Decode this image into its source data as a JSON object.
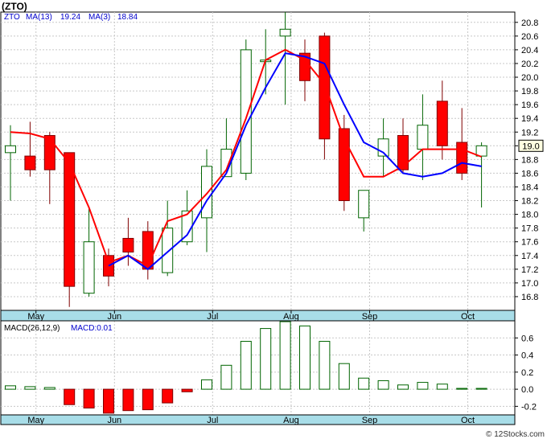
{
  "symbol": "(ZTO)",
  "watermark": "© 12Stocks.com",
  "chart_data": [
    {
      "type": "candlestick",
      "legend": {
        "ticker": "ZTO",
        "ma_long_label": "MA(13)",
        "ma_long_value": "19.24",
        "ma_short_label": "MA(3)",
        "ma_short_value": "18.84"
      },
      "colors": {
        "up": "#ffffff",
        "up_stroke": "#006400",
        "down": "#ff0000",
        "down_stroke": "#800000",
        "ma_short": "#ff0000",
        "ma_long": "#0000ff",
        "axis_band": "#a8dde8",
        "grid": "#c8c8c8"
      },
      "ylim": [
        16.6,
        20.95
      ],
      "y_ticks": [
        "16.8",
        "17.0",
        "17.2",
        "17.4",
        "17.6",
        "17.8",
        "18.0",
        "18.2",
        "18.4",
        "18.6",
        "18.8",
        "19.0",
        "19.2",
        "19.4",
        "19.6",
        "19.8",
        "20.0",
        "20.2",
        "20.4",
        "20.6",
        "20.8"
      ],
      "last_price": "19.0",
      "x_labels": [
        {
          "label": "May",
          "index": 1.3
        },
        {
          "label": "Jun",
          "index": 5.3
        },
        {
          "label": "Jul",
          "index": 10.3
        },
        {
          "label": "Aug",
          "index": 14.3
        },
        {
          "label": "Sep",
          "index": 18.3
        },
        {
          "label": "Oct",
          "index": 23.3
        }
      ],
      "candles": [
        {
          "o": 18.9,
          "c": 19.0,
          "h": 19.3,
          "l": 18.2
        },
        {
          "o": 18.85,
          "c": 18.65,
          "h": 19.35,
          "l": 18.55
        },
        {
          "o": 19.15,
          "c": 18.65,
          "h": 19.2,
          "l": 18.15
        },
        {
          "o": 18.9,
          "c": 16.95,
          "h": 18.9,
          "l": 16.65
        },
        {
          "o": 16.85,
          "c": 17.6,
          "h": 18.1,
          "l": 16.8
        },
        {
          "o": 17.4,
          "c": 17.1,
          "h": 17.5,
          "l": 16.95
        },
        {
          "o": 17.65,
          "c": 17.45,
          "h": 17.95,
          "l": 17.25
        },
        {
          "o": 17.75,
          "c": 17.2,
          "h": 17.9,
          "l": 17.05
        },
        {
          "o": 17.15,
          "c": 17.8,
          "h": 18.2,
          "l": 17.1
        },
        {
          "o": 17.6,
          "c": 18.05,
          "h": 18.35,
          "l": 17.55
        },
        {
          "o": 17.95,
          "c": 18.7,
          "h": 18.95,
          "l": 17.45
        },
        {
          "o": 18.55,
          "c": 18.95,
          "h": 19.4,
          "l": 18.55
        },
        {
          "o": 18.6,
          "c": 20.4,
          "h": 20.55,
          "l": 18.5
        },
        {
          "o": 20.25,
          "c": 20.25,
          "h": 20.7,
          "l": 19.75
        },
        {
          "o": 20.6,
          "c": 20.7,
          "h": 20.95,
          "l": 19.6
        },
        {
          "o": 20.35,
          "c": 19.95,
          "h": 20.55,
          "l": 19.65
        },
        {
          "o": 20.6,
          "c": 19.1,
          "h": 20.65,
          "l": 18.8
        },
        {
          "o": 19.25,
          "c": 18.2,
          "h": 19.45,
          "l": 18.05
        },
        {
          "o": 17.95,
          "c": 18.35,
          "h": 18.35,
          "l": 17.75
        },
        {
          "o": 18.85,
          "c": 19.1,
          "h": 19.4,
          "l": 18.55
        },
        {
          "o": 19.15,
          "c": 18.65,
          "h": 19.4,
          "l": 18.6
        },
        {
          "o": 18.95,
          "c": 19.3,
          "h": 19.75,
          "l": 18.5
        },
        {
          "o": 19.65,
          "c": 19.0,
          "h": 19.95,
          "l": 18.8
        },
        {
          "o": 19.05,
          "c": 18.6,
          "h": 19.55,
          "l": 18.5
        },
        {
          "o": 18.85,
          "c": 19.0,
          "h": 19.05,
          "l": 18.1
        }
      ],
      "ma_short": [
        {
          "i": 0,
          "v": 19.2
        },
        {
          "i": 1,
          "v": 19.18
        },
        {
          "i": 2,
          "v": 19.1
        },
        {
          "i": 3,
          "v": 18.75
        },
        {
          "i": 4,
          "v": 18.1
        },
        {
          "i": 5,
          "v": 17.3
        },
        {
          "i": 6,
          "v": 17.4
        },
        {
          "i": 7,
          "v": 17.25
        },
        {
          "i": 8,
          "v": 17.9
        },
        {
          "i": 9,
          "v": 18.0
        },
        {
          "i": 10,
          "v": 18.3
        },
        {
          "i": 11,
          "v": 18.65
        },
        {
          "i": 12,
          "v": 19.4
        },
        {
          "i": 13,
          "v": 20.25
        },
        {
          "i": 14,
          "v": 20.4
        },
        {
          "i": 15,
          "v": 20.25
        },
        {
          "i": 16,
          "v": 19.9
        },
        {
          "i": 17,
          "v": 19.1
        },
        {
          "i": 18,
          "v": 18.55
        },
        {
          "i": 19,
          "v": 18.55
        },
        {
          "i": 20,
          "v": 18.7
        },
        {
          "i": 21,
          "v": 18.95
        },
        {
          "i": 22,
          "v": 18.95
        },
        {
          "i": 23,
          "v": 18.95
        },
        {
          "i": 24,
          "v": 18.84
        }
      ],
      "ma_long": [
        {
          "i": 5,
          "v": 17.25
        },
        {
          "i": 6,
          "v": 17.4
        },
        {
          "i": 7,
          "v": 17.2
        },
        {
          "i": 8,
          "v": 17.45
        },
        {
          "i": 9,
          "v": 17.7
        },
        {
          "i": 10,
          "v": 18.2
        },
        {
          "i": 11,
          "v": 18.6
        },
        {
          "i": 12,
          "v": 19.3
        },
        {
          "i": 13,
          "v": 19.85
        },
        {
          "i": 14,
          "v": 20.35
        },
        {
          "i": 15,
          "v": 20.3
        },
        {
          "i": 16,
          "v": 20.2
        },
        {
          "i": 17,
          "v": 19.6
        },
        {
          "i": 18,
          "v": 19.05
        },
        {
          "i": 19,
          "v": 18.9
        },
        {
          "i": 20,
          "v": 18.6
        },
        {
          "i": 21,
          "v": 18.55
        },
        {
          "i": 22,
          "v": 18.6
        },
        {
          "i": 23,
          "v": 18.75
        },
        {
          "i": 24,
          "v": 18.7
        }
      ]
    },
    {
      "type": "bar",
      "legend": {
        "label": "MACD(26,12,9)",
        "value_label": "MACD:0.01"
      },
      "ylim": [
        -0.3,
        0.8
      ],
      "y_ticks": [
        "-0.2",
        "0.0",
        "0.2",
        "0.4",
        "0.6"
      ],
      "values": [
        0.04,
        0.03,
        0.02,
        -0.18,
        -0.22,
        -0.28,
        -0.25,
        -0.24,
        -0.16,
        -0.03,
        0.11,
        0.28,
        0.56,
        0.71,
        0.79,
        0.74,
        0.56,
        0.3,
        0.13,
        0.1,
        0.05,
        0.08,
        0.06,
        0.01,
        0.01
      ]
    }
  ]
}
